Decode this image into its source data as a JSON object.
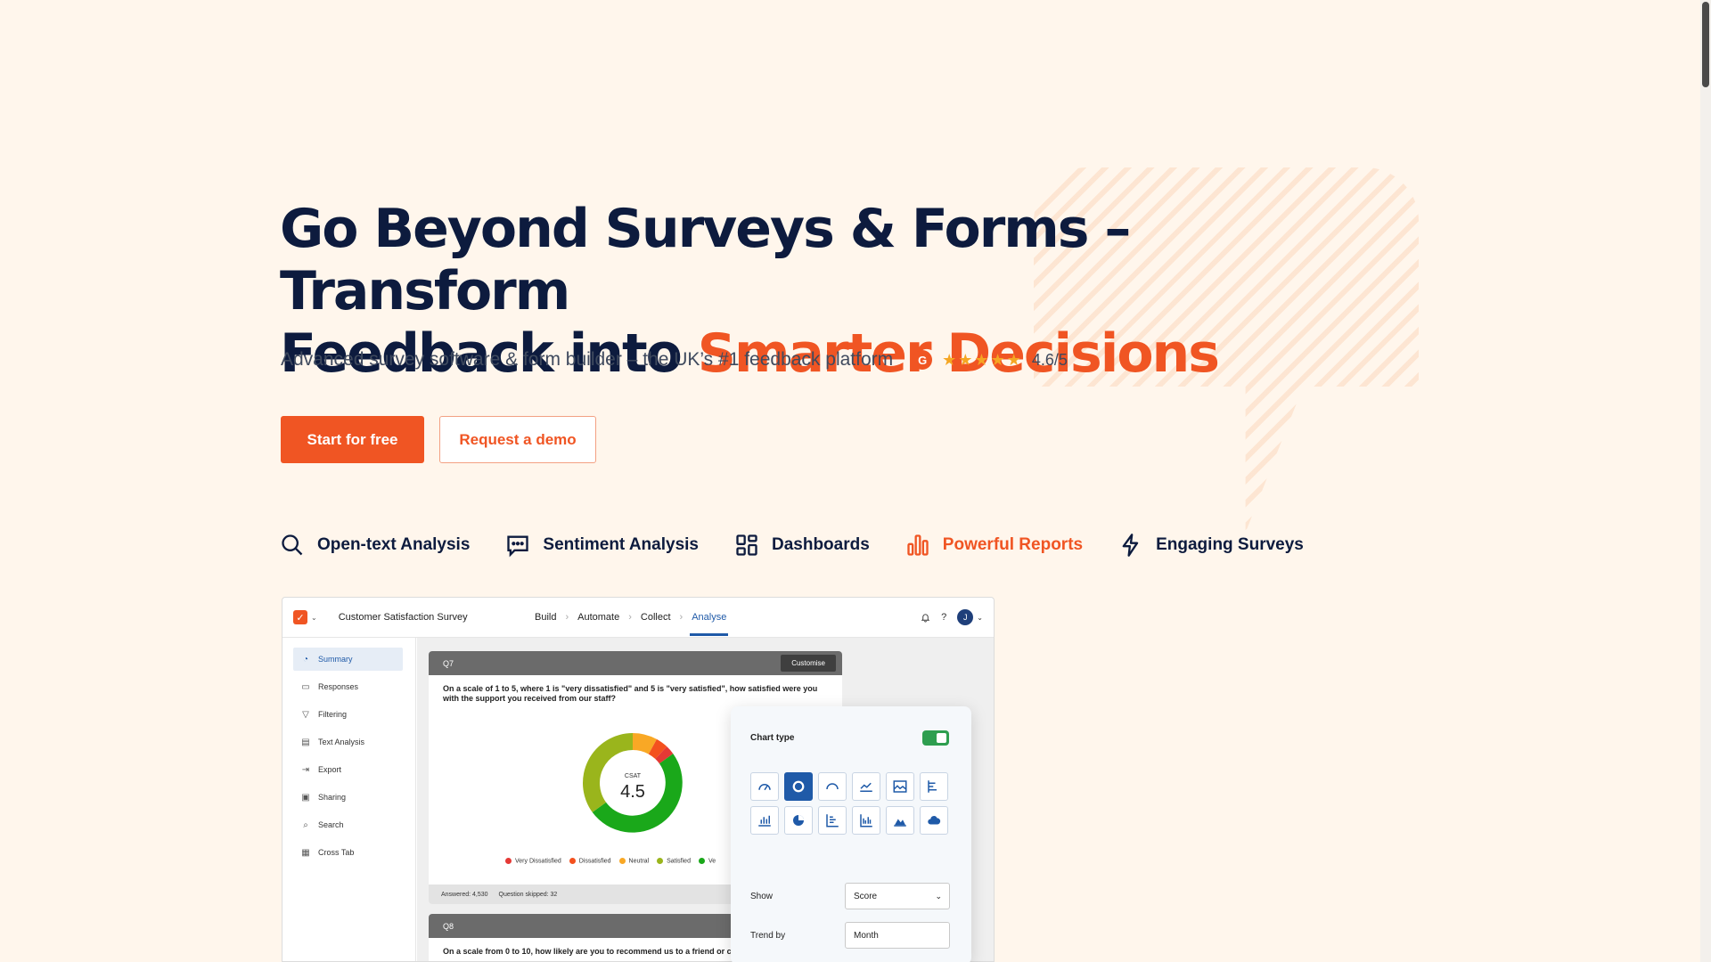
{
  "hero": {
    "headline_line1": "Go Beyond Surveys & Forms – Transform",
    "headline_line2_prefix": "Feedback into ",
    "headline_accent": "Smarter Decisions",
    "subline": "Advanced survey software & form builder – the UK’s #1 feedback platform",
    "g2_label": "G",
    "stars": "★★★★★",
    "rating": "4.6/5"
  },
  "buttons": {
    "primary": "Start for free",
    "secondary": "Request a demo"
  },
  "features": [
    {
      "label": "Open-text Analysis",
      "icon": "search-icon",
      "active": false
    },
    {
      "label": "Sentiment Analysis",
      "icon": "chat-icon",
      "active": false
    },
    {
      "label": "Dashboards",
      "icon": "dashboard-icon",
      "active": false
    },
    {
      "label": "Powerful Reports",
      "icon": "bar-chart-icon",
      "active": true
    },
    {
      "label": "Engaging Surveys",
      "icon": "lightning-icon",
      "active": false
    }
  ],
  "app": {
    "survey_title": "Customer Satisfaction Survey",
    "crumbs": [
      "Build",
      "Automate",
      "Collect",
      "Analyse"
    ],
    "active_crumb": "Analyse",
    "avatar_initial": "J",
    "sidebar": [
      {
        "label": "Summary",
        "icon": "summary-icon",
        "active": true
      },
      {
        "label": "Responses",
        "icon": "responses-icon",
        "active": false
      },
      {
        "label": "Filtering",
        "icon": "filter-icon",
        "active": false
      },
      {
        "label": "Text Analysis",
        "icon": "text-analysis-icon",
        "active": false
      },
      {
        "label": "Export",
        "icon": "export-icon",
        "active": false
      },
      {
        "label": "Sharing",
        "icon": "sharing-icon",
        "active": false
      },
      {
        "label": "Search",
        "icon": "search-icon",
        "active": false
      },
      {
        "label": "Cross Tab",
        "icon": "table-icon",
        "active": false
      }
    ],
    "q7": {
      "label": "Q7",
      "customise": "Customise",
      "text": "On a scale of 1 to 5, where 1 is \"very dissatisfied\" and 5 is \"very satisfied\", how satisfied were you with the support you received from our staff?",
      "csat_label": "CSAT",
      "csat_value": "4.5",
      "answered": "Answered: 4,530",
      "skipped": "Question skipped: 32"
    },
    "q8": {
      "label": "Q8",
      "text": "On a scale from 0 to 10, how likely are you to recommend us to a friend or co"
    }
  },
  "chart_data": {
    "type": "pie",
    "categories": [
      "Very Dissatisfied",
      "Dissatisfied",
      "Neutral",
      "Satisfied",
      "Very Satisfied"
    ],
    "legend_visible": [
      "Very Dissatisfied",
      "Dissatisfied",
      "Neutral",
      "Satisfied",
      "Ve"
    ],
    "values": [
      3,
      4,
      8,
      35,
      50
    ],
    "colors": [
      "#e53935",
      "#f4511e",
      "#f9a825",
      "#9ab51c",
      "#1aa81a"
    ],
    "center_label": "CSAT",
    "center_value": "4.5"
  },
  "chart_panel": {
    "title": "Chart type",
    "toggle_on": true,
    "chart_types": [
      "gauge",
      "donut",
      "semi-gauge",
      "line",
      "area-image",
      "bar-horizontal",
      "bar",
      "pie",
      "stacked-bar",
      "grouped-bar",
      "area",
      "word-cloud"
    ],
    "active_type": "donut",
    "show_label": "Show",
    "show_value": "Score",
    "trend_label": "Trend by",
    "trend_value": "Month"
  },
  "colors": {
    "background": "#fff6ec",
    "navy": "#0d1b3e",
    "accent": "#f05523",
    "blue": "#1f5aa8"
  }
}
